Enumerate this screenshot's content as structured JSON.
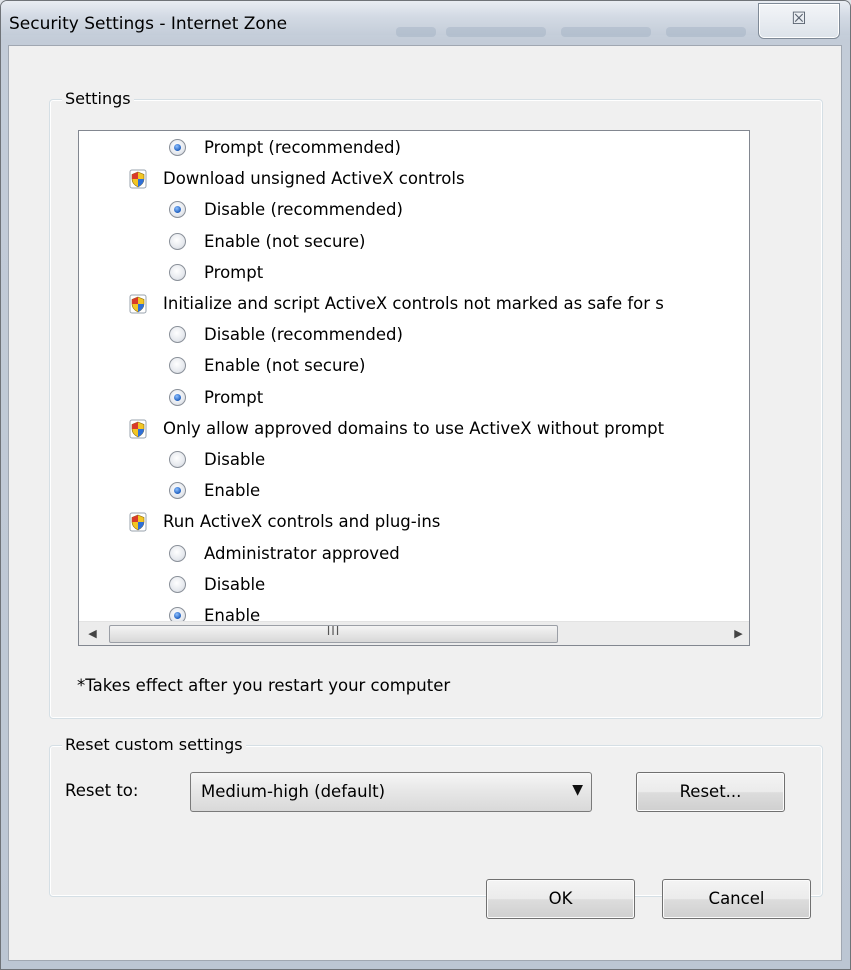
{
  "window": {
    "title": "Security Settings - Internet Zone",
    "close_glyph": "☒"
  },
  "settings_group": {
    "label": "Settings",
    "rows": [
      {
        "kind": "option",
        "text": "Prompt (recommended)",
        "checked": true
      },
      {
        "kind": "heading",
        "text": "Download unsigned ActiveX controls",
        "icon": "shield-icon"
      },
      {
        "kind": "option",
        "text": "Disable (recommended)",
        "checked": true
      },
      {
        "kind": "option",
        "text": "Enable (not secure)",
        "checked": false
      },
      {
        "kind": "option",
        "text": "Prompt",
        "checked": false
      },
      {
        "kind": "heading",
        "text": "Initialize and script ActiveX controls not marked as safe for s",
        "icon": "shield-icon"
      },
      {
        "kind": "option",
        "text": "Disable (recommended)",
        "checked": false
      },
      {
        "kind": "option",
        "text": "Enable (not secure)",
        "checked": false
      },
      {
        "kind": "option",
        "text": "Prompt",
        "checked": true
      },
      {
        "kind": "heading",
        "text": "Only allow approved domains to use ActiveX without prompt",
        "icon": "shield-icon"
      },
      {
        "kind": "option",
        "text": "Disable",
        "checked": false
      },
      {
        "kind": "option",
        "text": "Enable",
        "checked": true
      },
      {
        "kind": "heading",
        "text": "Run ActiveX controls and plug-ins",
        "icon": "shield-icon"
      },
      {
        "kind": "option",
        "text": "Administrator approved",
        "checked": false
      },
      {
        "kind": "option",
        "text": "Disable",
        "checked": false
      },
      {
        "kind": "option",
        "text": "Enable",
        "checked": true
      }
    ],
    "scroll_up_glyph": "▲",
    "scroll_down_glyph": "▼",
    "scroll_left_glyph": "◀",
    "scroll_right_glyph": "▶",
    "hthumb_grip": "III",
    "note": "*Takes effect after you restart your computer"
  },
  "reset_group": {
    "label": "Reset custom settings",
    "reset_to_label": "Reset to:",
    "selected_level": "Medium-high (default)",
    "dropdown_glyph": "▼",
    "reset_button": "Reset..."
  },
  "footer": {
    "ok_button": "OK",
    "cancel_button": "Cancel"
  },
  "colors": {
    "radio_selected": "#1f5fbf",
    "shield_yellow": "#f3c623",
    "shield_blue": "#2f6fd6",
    "shield_red": "#d83a2a"
  }
}
